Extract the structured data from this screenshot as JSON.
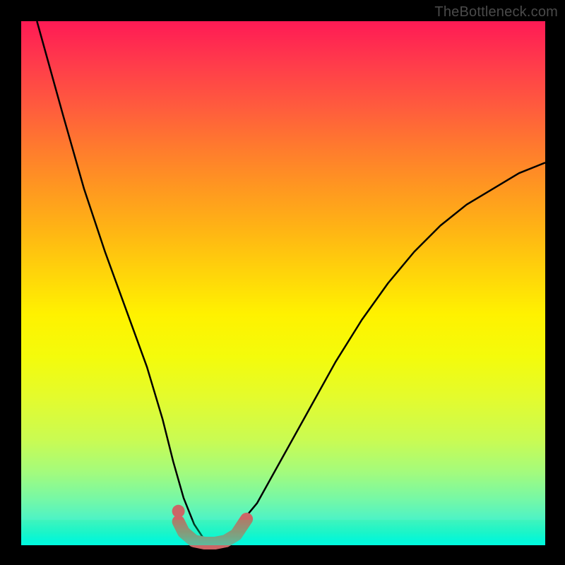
{
  "watermark": "TheBottleneck.com",
  "chart_data": {
    "type": "line",
    "title": "",
    "xlabel": "",
    "ylabel": "",
    "xlim": [
      0,
      100
    ],
    "ylim": [
      0,
      100
    ],
    "grid": false,
    "legend": null,
    "series": [
      {
        "name": "curve",
        "x": [
          3,
          8,
          12,
          16,
          20,
          24,
          27,
          29,
          31,
          33,
          35,
          37,
          40,
          45,
          50,
          55,
          60,
          65,
          70,
          75,
          80,
          85,
          90,
          95,
          100
        ],
        "values": [
          100,
          82,
          68,
          56,
          45,
          34,
          24,
          16,
          9,
          4,
          1,
          1,
          2,
          8,
          17,
          26,
          35,
          43,
          50,
          56,
          61,
          65,
          68,
          71,
          73
        ]
      },
      {
        "name": "highlight-band",
        "x": [
          30,
          31,
          33,
          35,
          37,
          39,
          41,
          43
        ],
        "values": [
          4.5,
          2.5,
          0.8,
          0.4,
          0.4,
          0.8,
          2.0,
          5.0
        ]
      }
    ],
    "colors": {
      "curve": "#000000",
      "highlight": "#cc6666"
    }
  }
}
